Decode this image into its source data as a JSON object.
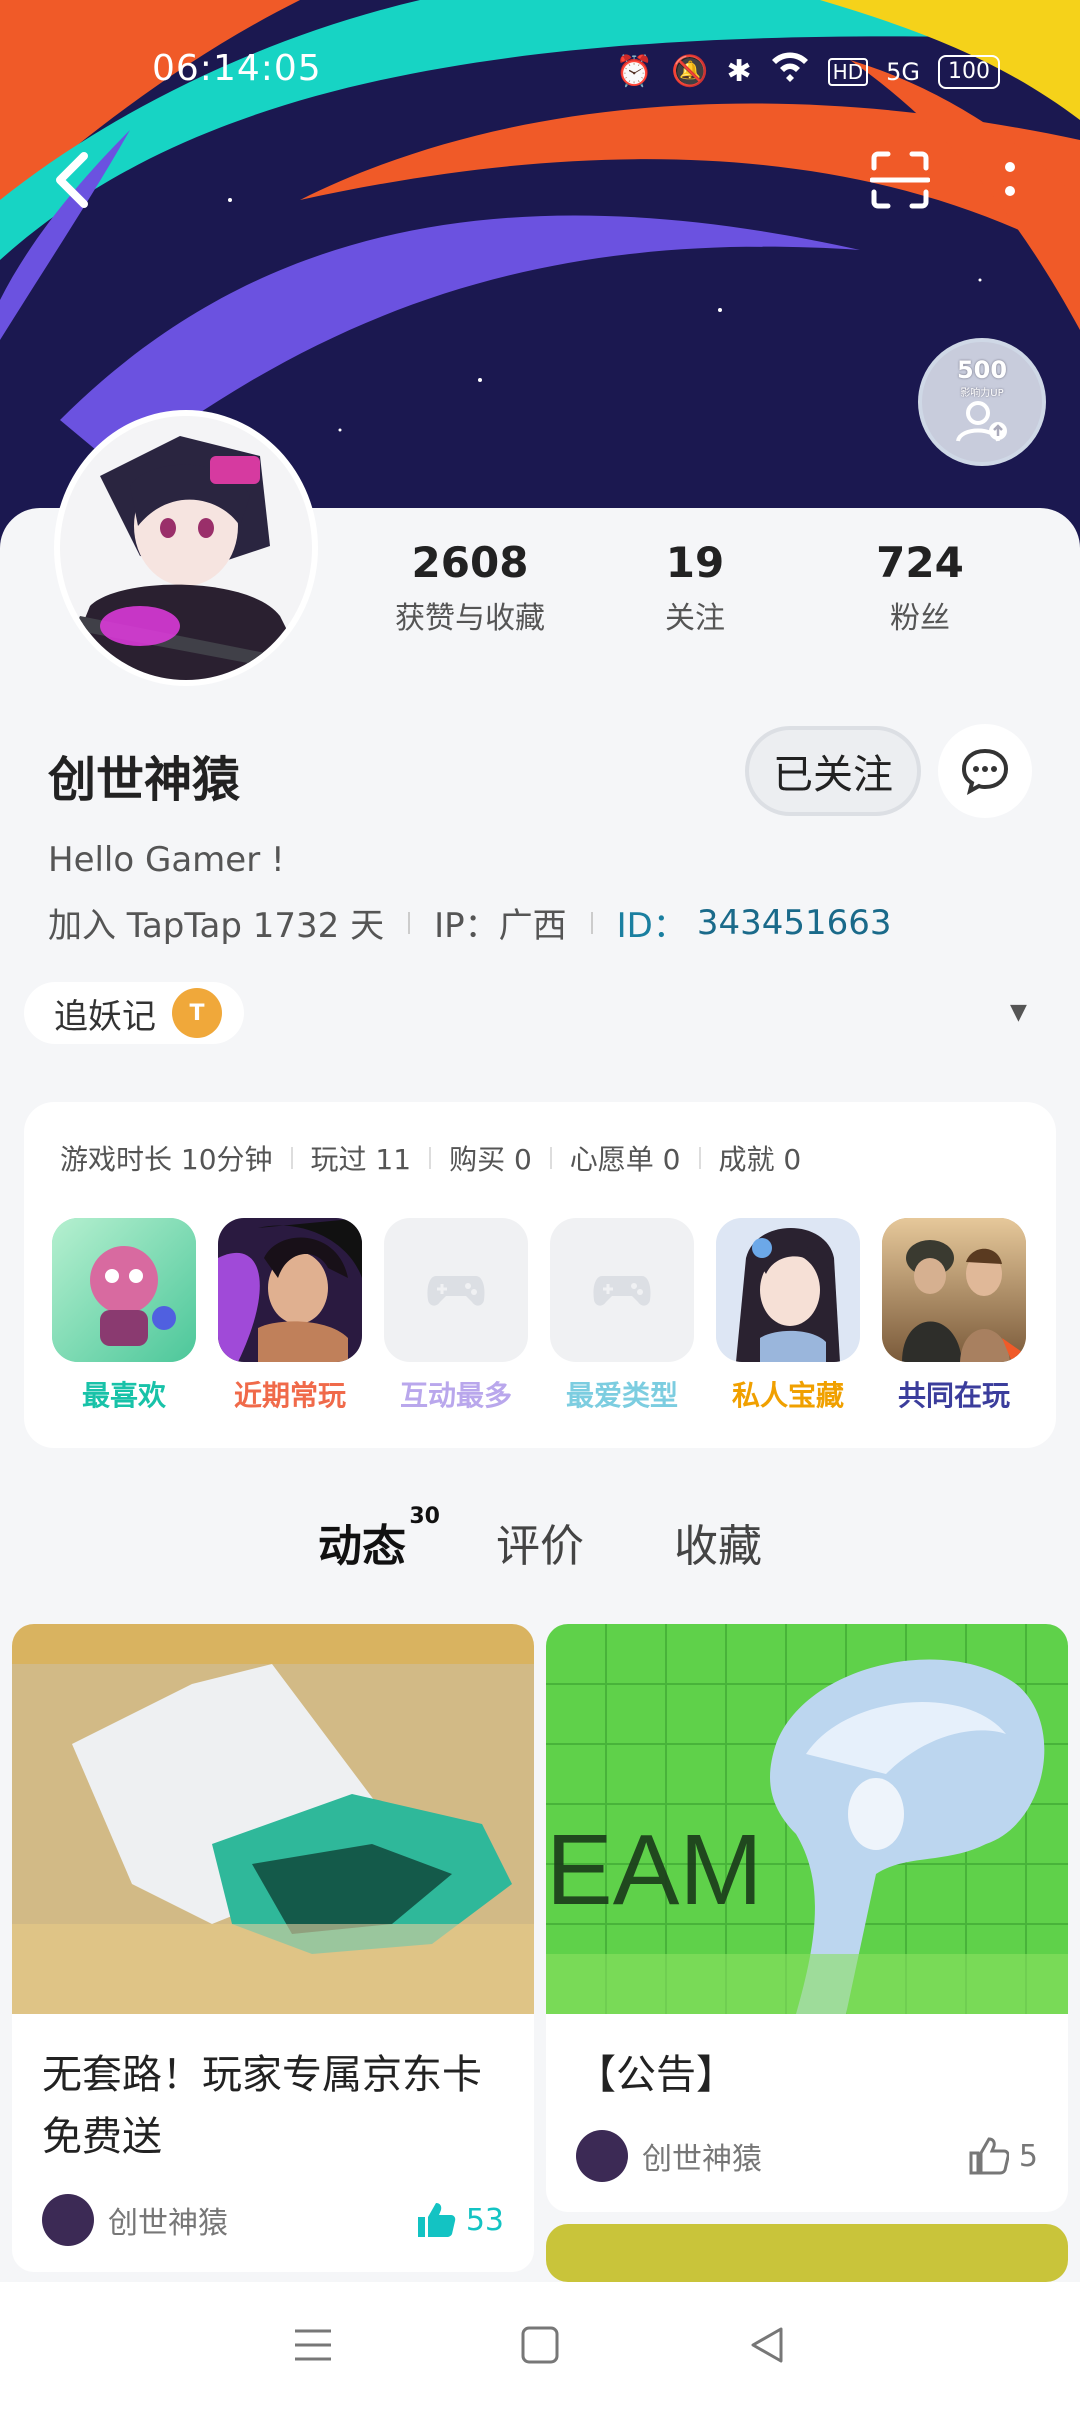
{
  "status_bar": {
    "time": "06:14:05",
    "network": "5G",
    "hd": "HD",
    "battery": "100"
  },
  "header": {
    "badge": {
      "number": "500",
      "text": "影响力UP"
    }
  },
  "profile": {
    "stats": [
      {
        "value": "2608",
        "label": "获赞与收藏"
      },
      {
        "value": "19",
        "label": "关注"
      },
      {
        "value": "724",
        "label": "粉丝"
      }
    ],
    "name": "创世神猿",
    "follow_label": "已关注",
    "bio": "Hello Gamer !",
    "joined": "加入 TapTap 1732 天",
    "ip": "IP：广西",
    "id_label": "ID：",
    "id_value": "343451663",
    "game_tag": "追妖记"
  },
  "game_summary": {
    "stats": [
      "游戏时长 10分钟",
      "玩过 11",
      "购买 0",
      "心愿单 0",
      "成就 0"
    ],
    "tiles": [
      {
        "label": "最喜欢",
        "color": "#18c2a8"
      },
      {
        "label": "近期常玩",
        "color": "#f06a4a"
      },
      {
        "label": "互动最多",
        "color": "#b9a7ec"
      },
      {
        "label": "最爱类型",
        "color": "#7ccde0"
      },
      {
        "label": "私人宝藏",
        "color": "#f0a000"
      },
      {
        "label": "共同在玩",
        "color": "#3b3d9c"
      }
    ]
  },
  "tabs": [
    {
      "label": "动态",
      "count": "30"
    },
    {
      "label": "评价"
    },
    {
      "label": "收藏"
    }
  ],
  "posts": [
    {
      "title": "无套路！玩家专属京东卡免费送",
      "author": "创世神猿",
      "likes": "53"
    },
    {
      "title": "【公告】",
      "author": "创世神猿",
      "likes": "5"
    }
  ],
  "colors": {
    "accent": "#13c3c3",
    "id_color": "#1a7fa0"
  }
}
